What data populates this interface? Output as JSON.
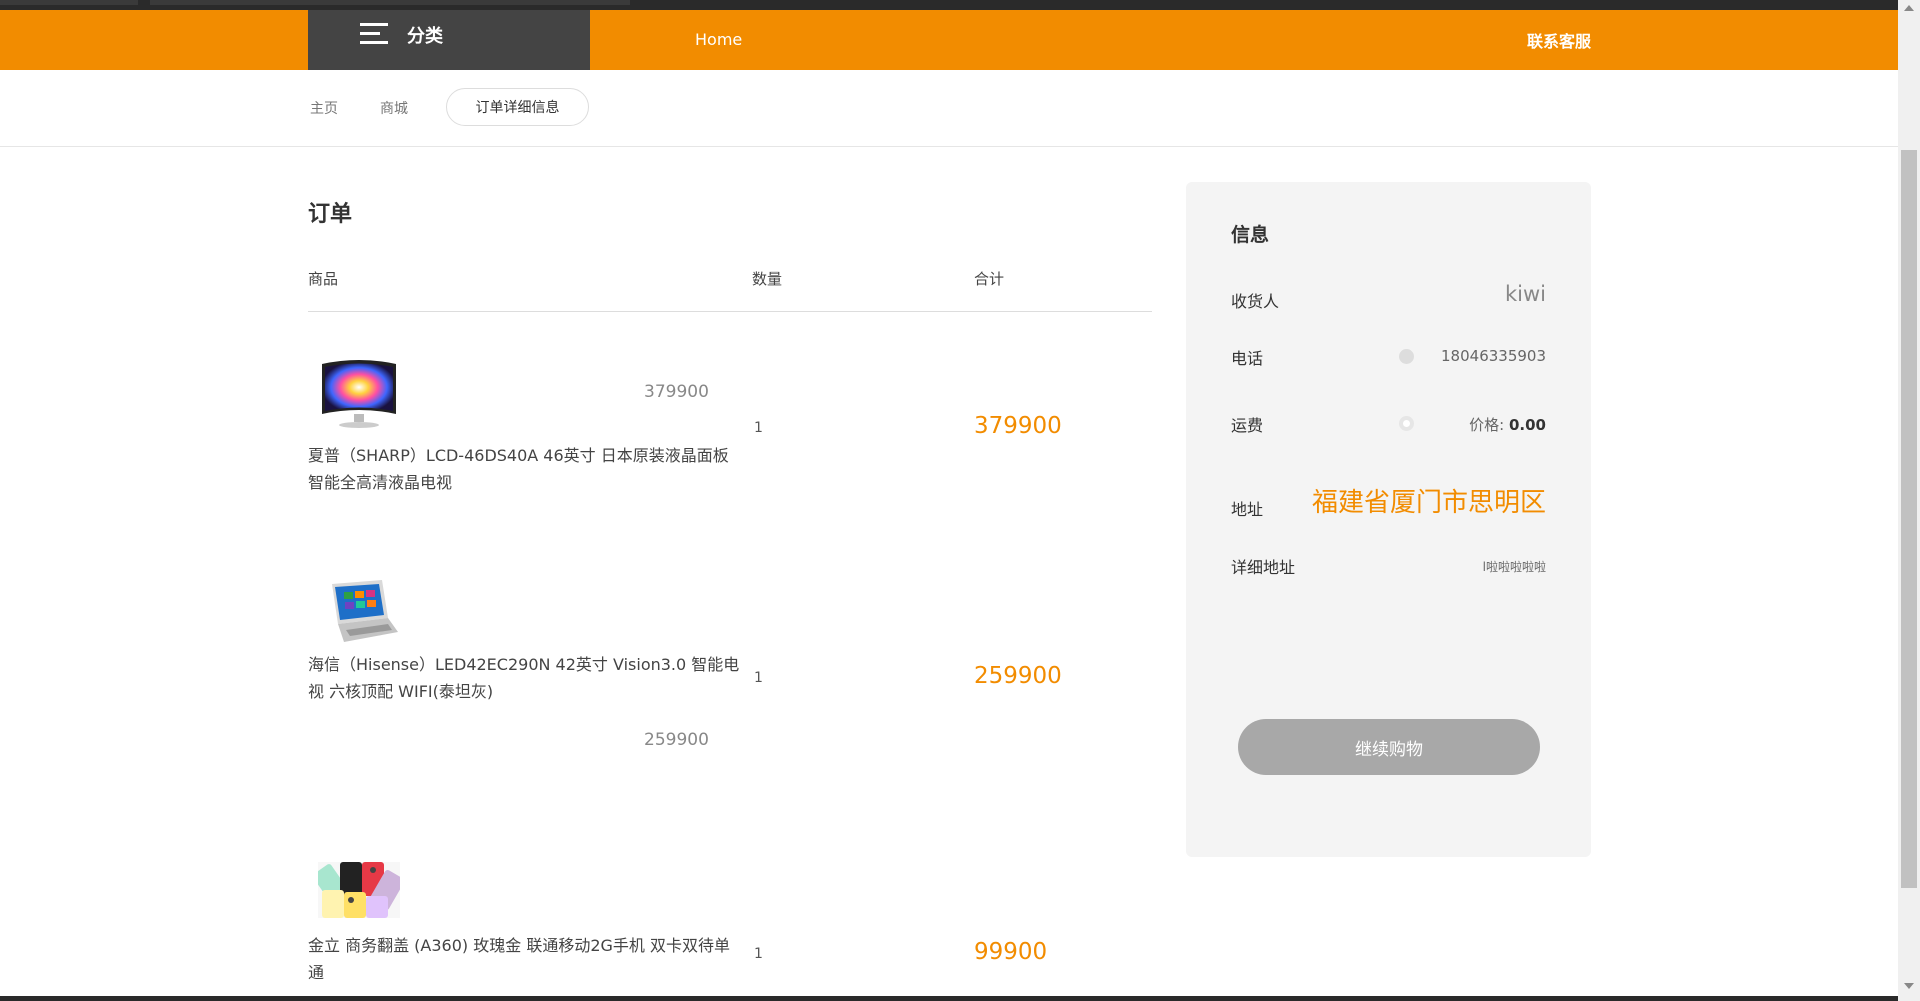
{
  "navbar": {
    "category_label": "分类",
    "home_label": "Home",
    "contact_label": "联系客服"
  },
  "breadcrumb": {
    "items": [
      "主页",
      "商城"
    ],
    "active": "订单详细信息"
  },
  "order": {
    "title": "订单",
    "columns": [
      "商品",
      "数量",
      "合计"
    ],
    "items": [
      {
        "thumb_icon": "curved-monitor-icon",
        "price": "379900",
        "name_line1": "夏普（SHARP）LCD-46DS40A 46英寸 日本原装液晶面板",
        "name_line2": "智能全高清液晶电视",
        "quantity": "1",
        "total": "379900"
      },
      {
        "thumb_icon": "laptop-icon",
        "price": "259900",
        "name_line1": "海信（Hisense）LED42EC290N 42英寸 Vision3.0 智能电",
        "name_line2": "视 六核顶配 WIFI(泰坦灰)",
        "quantity": "1",
        "total": "259900"
      },
      {
        "thumb_icon": "phones-icon",
        "name_line1": "金立 商务翻盖 (A360) 玫瑰金 联通移动2G手机 双卡双待单",
        "name_line2": "通",
        "quantity": "1",
        "total": "99900"
      }
    ]
  },
  "info": {
    "title": "信息",
    "receiver_label": "收货人",
    "receiver_value": "kiwi",
    "phone_label": "电话",
    "phone_value": "18046335903",
    "shipping_label": "运费",
    "shipping_value_prefix": "价格:",
    "shipping_value": "0.00",
    "address_label": "地址",
    "address_value": "福建省厦门市思明区",
    "detail_label": "详细地址",
    "detail_value": "l啦啦啦啦啦",
    "continue_label": "继续购物"
  },
  "colors": {
    "brand_orange": "#f28c00",
    "dark_block": "#444444",
    "panel_bg": "#f4f4f4",
    "button_gray": "#a8a8a8"
  }
}
